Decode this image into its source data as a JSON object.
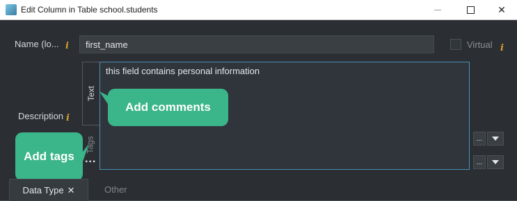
{
  "window": {
    "title": "Edit Column in Table school.students"
  },
  "form": {
    "name_label": "Name (lo...",
    "name_value": "first_name",
    "virtual_label": "Virtual",
    "info_glyph": "i",
    "description_label": "Description",
    "side_tabs": {
      "text": "Text",
      "tags": "Tags"
    },
    "comment_value": "this field contains personal information",
    "ellipsis": "...",
    "small_button": "..."
  },
  "callouts": {
    "comments": "Add comments",
    "tags": "Add tags"
  },
  "tabs": {
    "datatype": "Data Type",
    "close_glyph": "✕",
    "other": "Other"
  },
  "colors": {
    "background": "#2b2f33",
    "accent_green": "#3bb58a",
    "info_icon": "#d4a32a",
    "focus_border": "#4d8fb8"
  }
}
